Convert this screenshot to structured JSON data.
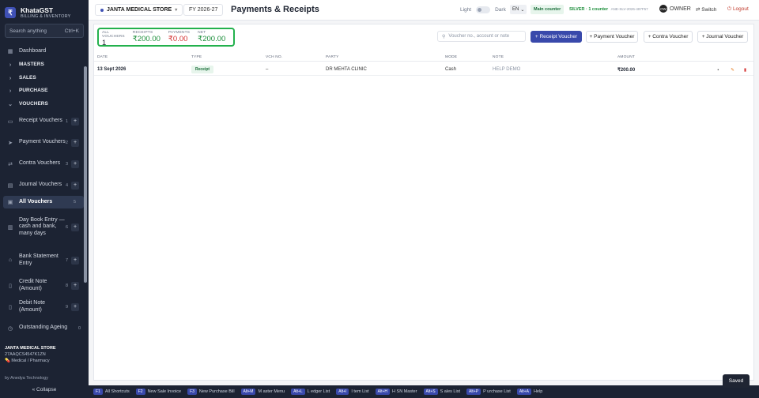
{
  "brand": {
    "logo": "₹",
    "title": "KhataGST",
    "subtitle": "BILLING & INVENTORY"
  },
  "search": {
    "placeholder": "Search anything",
    "shortcut": "Ctrl+K"
  },
  "sidebar": {
    "dashboard": "Dashboard",
    "masters": "MASTERS",
    "sales": "SALES",
    "purchase": "PURCHASE",
    "vouchers": "VOUCHERS",
    "items": [
      {
        "label": "Receipt Vouchers",
        "num": "1"
      },
      {
        "label": "Payment Vouchers",
        "num": "2"
      },
      {
        "label": "Contra Vouchers",
        "num": "3"
      },
      {
        "label": "Journal Vouchers",
        "num": "4"
      },
      {
        "label": "All Vouchers",
        "num": "5"
      },
      {
        "label": "Day Book Entry — cash and bank, many days",
        "num": "6"
      },
      {
        "label": "Bank Statement Entry",
        "num": "7"
      },
      {
        "label": "Credit Note (Amount)",
        "num": "8"
      },
      {
        "label": "Debit Note (Amount)",
        "num": "9"
      },
      {
        "label": "Outstanding Ageing",
        "num": "0"
      }
    ],
    "store_name": "JANTA MEDICAL STORE",
    "gstin": "27AAQCS4547K1ZN",
    "category": "Medical / Pharmacy",
    "by": "by Anedya Technology",
    "collapse": "« Collapse"
  },
  "topbar": {
    "store": "JANTA MEDICAL STORE",
    "fy": "FY 2026-27",
    "title": "Payments & Receipts",
    "light": "Light",
    "dark": "Dark",
    "lang": "EN",
    "counter": "Main counter",
    "plan": "SILVER · 1 counter",
    "plan_code": "ANE-SLV-2026-487F57",
    "owner_initials": "OW",
    "owner": "OWNER",
    "switch": "⇄ Switch",
    "logout": "⏻ Logout"
  },
  "stats": {
    "all_label": "ALL VOUCHERS",
    "all_value": "1",
    "receipts_label": "RECEIPTS",
    "receipts_value": "₹200.00",
    "payments_label": "PAYMENTS",
    "payments_value": "₹0.00",
    "net_label": "NET",
    "net_value": "₹200.00"
  },
  "toolbar": {
    "search_placeholder": "Voucher no., account or note",
    "receipt_btn": "+ Receipt Voucher",
    "payment_btn": "+ Payment Voucher",
    "contra_btn": "+ Contra Voucher",
    "journal_btn": "+ Journal Voucher"
  },
  "table": {
    "headers": [
      "DATE",
      "TYPE",
      "VCH NO.",
      "PARTY",
      "MODE",
      "NOTE",
      "AMOUNT"
    ],
    "rows": [
      {
        "date": "13 Sept 2026",
        "type": "Receipt",
        "vch": "–",
        "party": "DR MEHTA CLINIC",
        "mode": "Cash",
        "note": "HELP DEMO",
        "amount": "₹200.00"
      }
    ]
  },
  "shortcuts": [
    {
      "key": "F1",
      "label": "All Shortcuts"
    },
    {
      "key": "F2",
      "label": "New Sale Invoice"
    },
    {
      "key": "F3",
      "label": "New Purchase Bill"
    },
    {
      "key": "Alt+M",
      "label": "M aster Menu"
    },
    {
      "key": "Alt+L",
      "label": "L edger List"
    },
    {
      "key": "Alt+I",
      "label": "I tem List"
    },
    {
      "key": "Alt+H",
      "label": "H SN Master"
    },
    {
      "key": "Alt+S",
      "label": "S ales List"
    },
    {
      "key": "Alt+P",
      "label": "P urchase List"
    },
    {
      "key": "Alt+A",
      "label": "Help"
    }
  ],
  "toast": "Saved",
  "colors": {
    "sidebar": "#1c2333",
    "accent": "#3949ab",
    "success": "#1b8e3a",
    "danger": "#d32f2f",
    "highlight": "#23b14d"
  }
}
